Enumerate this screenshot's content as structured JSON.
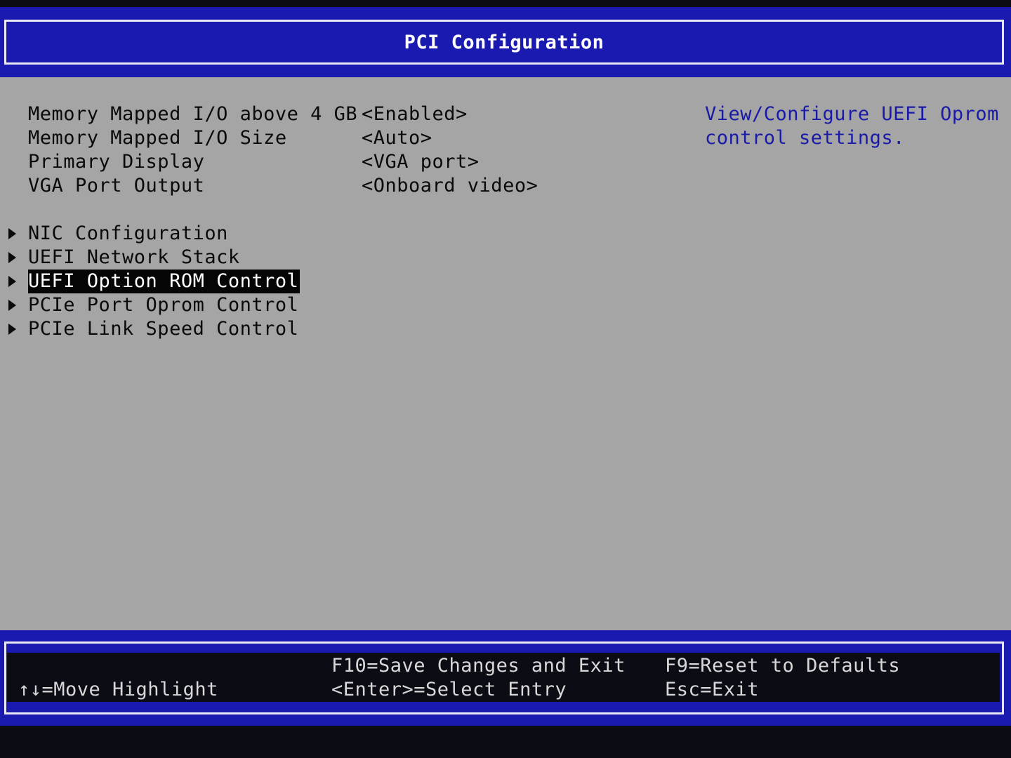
{
  "header": {
    "title": "PCI Configuration"
  },
  "settings": [
    {
      "label": "Memory Mapped I/O above 4 GB",
      "value": "<Enabled>"
    },
    {
      "label": "Memory Mapped I/O Size",
      "value": "<Auto>"
    },
    {
      "label": "Primary Display",
      "value": "<VGA port>"
    },
    {
      "label": "VGA Port Output",
      "value": "<Onboard video>"
    }
  ],
  "submenus": [
    {
      "label": "NIC Configuration"
    },
    {
      "label": "UEFI Network Stack"
    },
    {
      "label": "UEFI Option ROM Control",
      "selected": true
    },
    {
      "label": "PCIe Port Oprom Control"
    },
    {
      "label": "PCIe Link Speed Control"
    }
  ],
  "help": {
    "line1": "View/Configure UEFI Oprom",
    "line2": "control settings."
  },
  "footer": {
    "move_highlight": "↑↓=Move Highlight",
    "save_exit": "F10=Save Changes and Exit",
    "select_entry": "<Enter>=Select Entry",
    "reset_defaults": "F9=Reset to Defaults",
    "exit": "Esc=Exit"
  },
  "colors": {
    "frame_blue": "#1a1ab0",
    "panel_gray": "#a5a5a5",
    "help_text_blue": "#1a1aa8",
    "highlight_bg": "#050505"
  }
}
